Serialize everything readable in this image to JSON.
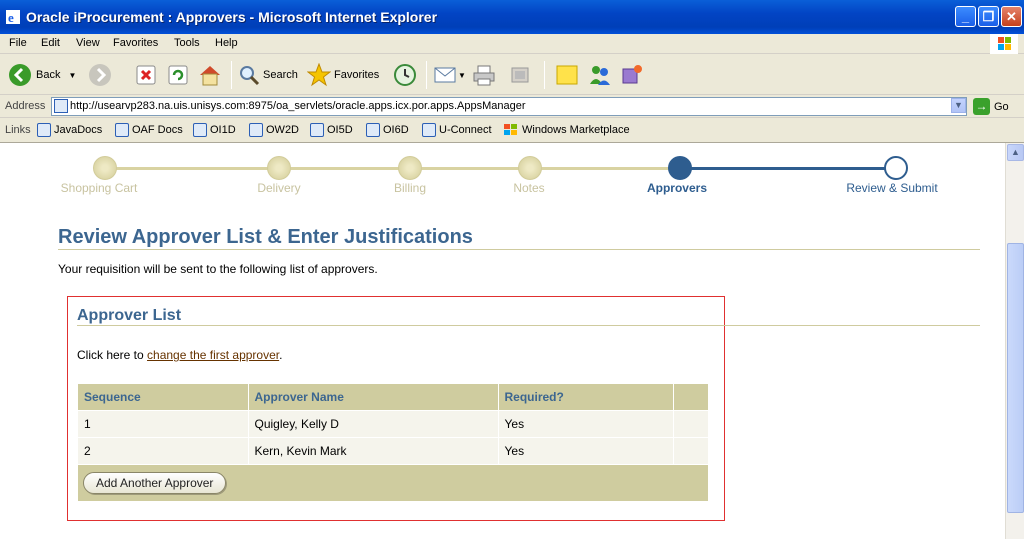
{
  "window": {
    "title": "Oracle iProcurement : Approvers - Microsoft Internet Explorer",
    "minimize": "_",
    "maximize": "❐",
    "close": "✕"
  },
  "menu": [
    "File",
    "Edit",
    "View",
    "Favorites",
    "Tools",
    "Help"
  ],
  "toolbar": {
    "back_label": "Back",
    "search_label": "Search",
    "favorites_label": "Favorites"
  },
  "address": {
    "label": "Address",
    "url": "http://usearvp283.na.uis.unisys.com:8975/oa_servlets/oracle.apps.icx.por.apps.AppsManager",
    "go_label": "Go"
  },
  "links": {
    "label": "Links",
    "items": [
      "JavaDocs",
      "OAF Docs",
      "OI1D",
      "OW2D",
      "OI5D",
      "OI6D",
      "U-Connect",
      "Windows Marketplace"
    ]
  },
  "train": {
    "steps": [
      "Shopping Cart",
      "Delivery",
      "Billing",
      "Notes",
      "Approvers",
      "Review & Submit"
    ],
    "current": "Approvers"
  },
  "page": {
    "title": "Review Approver List & Enter Justifications",
    "description": "Your requisition will be sent to the following list of approvers."
  },
  "approver_list": {
    "title": "Approver List",
    "click_prefix": "Click here to ",
    "click_link": "change the first approver",
    "click_suffix": ".",
    "columns": [
      "Sequence",
      "Approver Name",
      "Required?",
      ""
    ],
    "rows": [
      {
        "sequence": "1",
        "name": "Quigley, Kelly D",
        "required": "Yes"
      },
      {
        "sequence": "2",
        "name": "Kern, Kevin Mark",
        "required": "Yes"
      }
    ],
    "add_button": "Add Another Approver"
  },
  "colors": {
    "accent": "#3c6690",
    "header_bg": "#cfcc9f",
    "highlight_border": "#e03030"
  }
}
